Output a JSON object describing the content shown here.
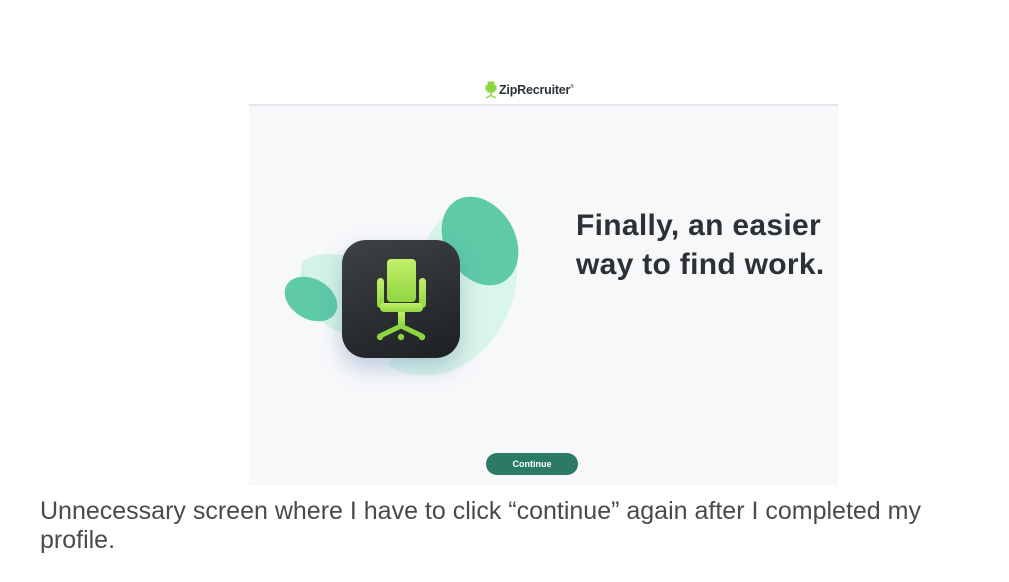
{
  "app": {
    "logo_text": "ZipRecruiter",
    "logo_trademark": "®",
    "logo_icon": "office-chair-icon"
  },
  "main": {
    "headline": "Finally, an easier way to find work.",
    "illustration_icon": "office-chair-icon",
    "continue_label": "Continue"
  },
  "caption": {
    "text": "Unnecessary screen where I have to click “continue” again after I completed my profile."
  },
  "colors": {
    "brand_green": "#8ed641",
    "button_green": "#2c7a66",
    "blob_teal": "#5ecaa8",
    "headline_text": "#2d3134"
  }
}
